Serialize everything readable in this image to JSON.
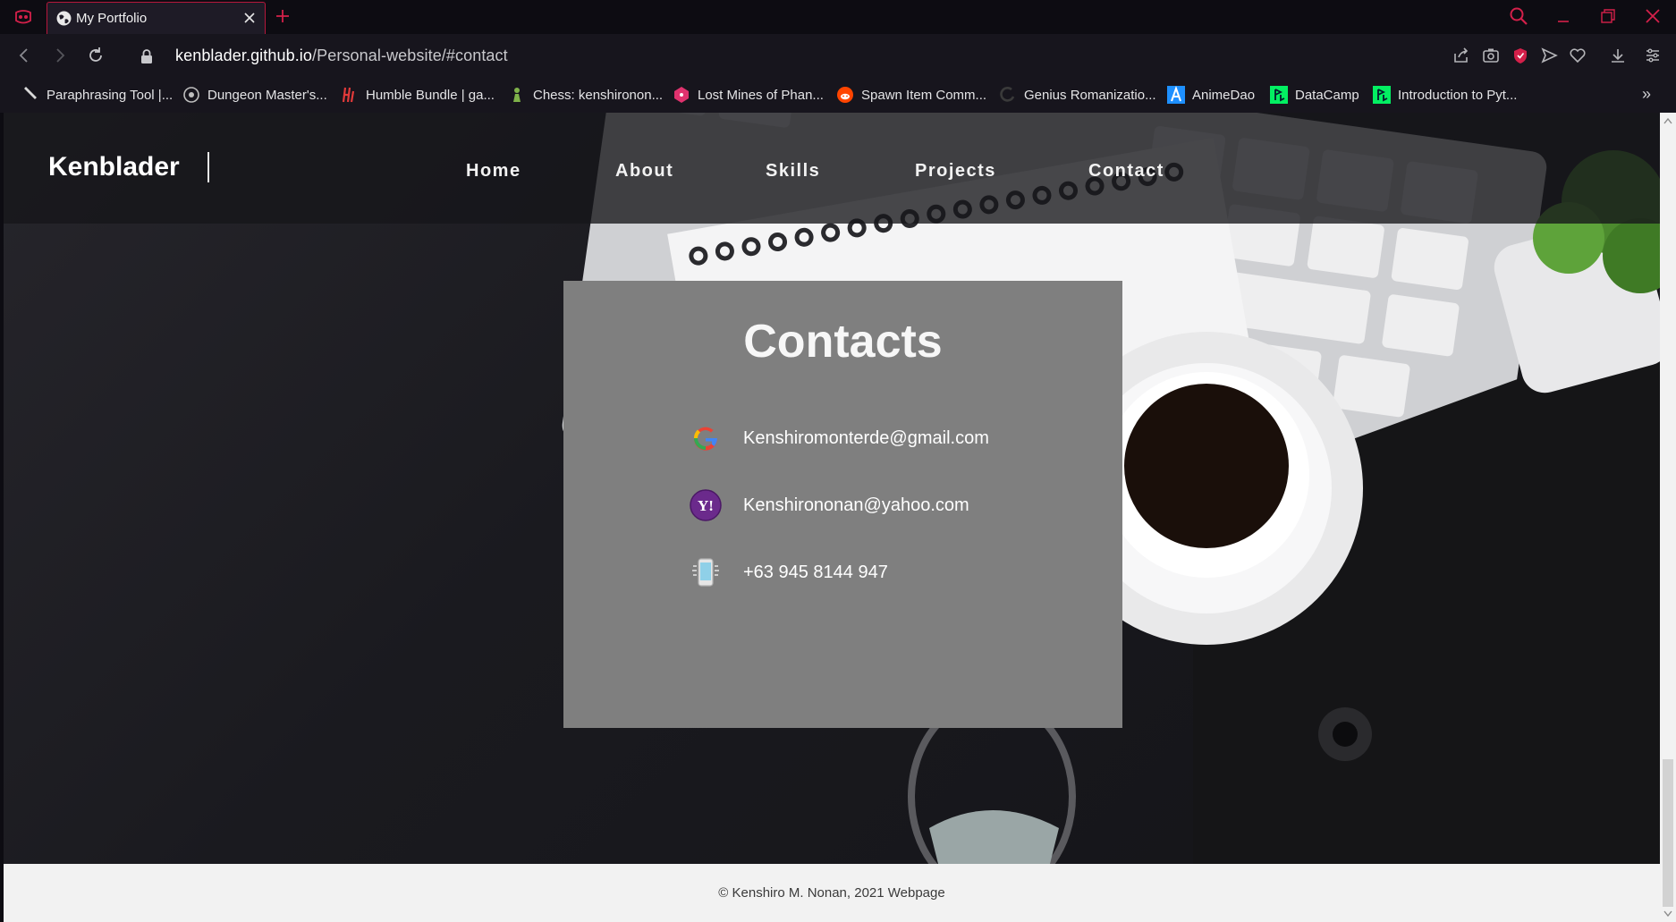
{
  "browser": {
    "tab_title": "My Portfolio",
    "url_host": "kenblader.github.io",
    "url_path": "/Personal-website/#contact",
    "accent": "#b6173b"
  },
  "bookmarks": [
    {
      "label": "Paraphrasing Tool |...",
      "icon": "quill-icon"
    },
    {
      "label": "Dungeon Master's...",
      "icon": "dnd-icon"
    },
    {
      "label": "Humble Bundle | ga...",
      "icon": "humble-icon"
    },
    {
      "label": "Chess: kenshironon...",
      "icon": "pawn-icon"
    },
    {
      "label": "Lost Mines of Phan...",
      "icon": "dice-icon"
    },
    {
      "label": "Spawn Item Comm...",
      "icon": "reddit-icon"
    },
    {
      "label": "Genius Romanizatio...",
      "icon": "genius-icon"
    },
    {
      "label": "AnimeDao",
      "icon": "animedao-icon"
    },
    {
      "label": "DataCamp",
      "icon": "datacamp-icon"
    },
    {
      "label": "Introduction to Pyt...",
      "icon": "datacamp-icon"
    }
  ],
  "site": {
    "brand": "Kenblader",
    "nav": [
      "Home",
      "About",
      "Skills",
      "Projects",
      "Contact"
    ],
    "contact": {
      "title": "Contacts",
      "items": [
        {
          "icon": "google-icon",
          "text": "Kenshiromonterde@gmail.com"
        },
        {
          "icon": "yahoo-icon",
          "text": "Kenshirononan@yahoo.com"
        },
        {
          "icon": "phone-icon",
          "text": "+63 945 8144 947"
        }
      ]
    },
    "footer": "© Kenshiro M. Nonan, 2021 Webpage"
  }
}
